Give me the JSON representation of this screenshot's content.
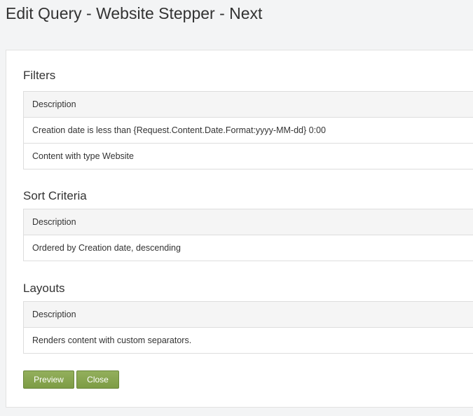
{
  "page": {
    "title": "Edit Query - Website Stepper - Next"
  },
  "filters": {
    "heading": "Filters",
    "column_header": "Description",
    "rows": [
      "Creation date is less than {Request.Content.Date.Format:yyyy-MM-dd} 0:00",
      "Content with type Website"
    ]
  },
  "sort_criteria": {
    "heading": "Sort Criteria",
    "column_header": "Description",
    "rows": [
      "Ordered by Creation date, descending"
    ]
  },
  "layouts": {
    "heading": "Layouts",
    "column_header": "Description",
    "rows": [
      "Renders content with custom separators."
    ]
  },
  "actions": {
    "preview_label": "Preview",
    "close_label": "Close"
  },
  "colors": {
    "button_green": "#7d9c45",
    "page_background": "#f3f4f5",
    "table_header_background": "#f5f5f5"
  }
}
